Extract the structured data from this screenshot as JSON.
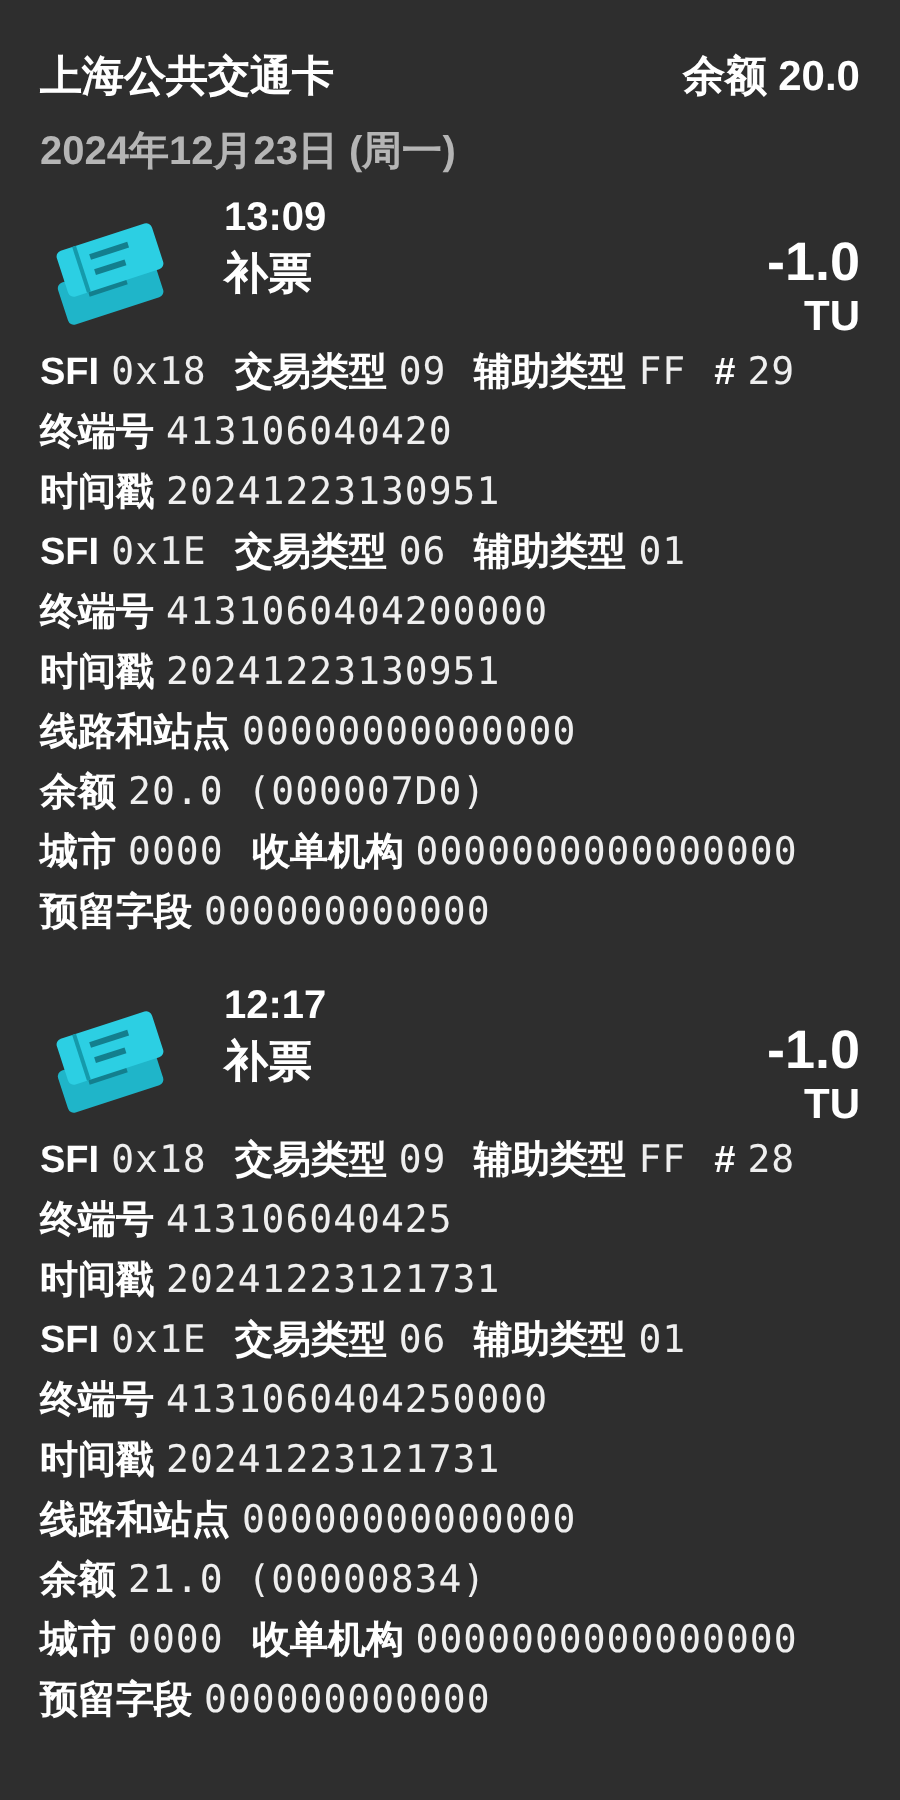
{
  "header": {
    "title": "上海公共交通卡",
    "balance": "余额 20.0"
  },
  "date": "2024年12月23日 (周一)",
  "transactions": [
    {
      "time": "13:09",
      "type": "补票",
      "amount": "-1.0",
      "unit": "TU",
      "details": [
        [
          {
            "label": "SFI",
            "value": "0x18"
          },
          {
            "label": "交易类型",
            "value": "09"
          },
          {
            "label": "辅助类型",
            "value": "FF"
          },
          {
            "label": "#",
            "value": "29"
          }
        ],
        [
          {
            "label": "终端号",
            "value": "413106040420"
          }
        ],
        [
          {
            "label": "时间戳",
            "value": "20241223130951"
          }
        ],
        [
          {
            "label": "SFI",
            "value": "0x1E"
          },
          {
            "label": "交易类型",
            "value": "06"
          },
          {
            "label": "辅助类型",
            "value": "01"
          }
        ],
        [
          {
            "label": "终端号",
            "value": "4131060404200000"
          }
        ],
        [
          {
            "label": "时间戳",
            "value": "20241223130951"
          }
        ],
        [
          {
            "label": "线路和站点",
            "value": "00000000000000"
          }
        ],
        [
          {
            "label": "余额",
            "value": "20.0 (000007D0)"
          }
        ],
        [
          {
            "label": "城市",
            "value": "0000"
          },
          {
            "label": "收单机构",
            "value": "0000000000000000"
          }
        ],
        [
          {
            "label": "预留字段",
            "value": "000000000000"
          }
        ]
      ]
    },
    {
      "time": "12:17",
      "type": "补票",
      "amount": "-1.0",
      "unit": "TU",
      "details": [
        [
          {
            "label": "SFI",
            "value": "0x18"
          },
          {
            "label": "交易类型",
            "value": "09"
          },
          {
            "label": "辅助类型",
            "value": "FF"
          },
          {
            "label": "#",
            "value": "28"
          }
        ],
        [
          {
            "label": "终端号",
            "value": "413106040425"
          }
        ],
        [
          {
            "label": "时间戳",
            "value": "20241223121731"
          }
        ],
        [
          {
            "label": "SFI",
            "value": "0x1E"
          },
          {
            "label": "交易类型",
            "value": "06"
          },
          {
            "label": "辅助类型",
            "value": "01"
          }
        ],
        [
          {
            "label": "终端号",
            "value": "4131060404250000"
          }
        ],
        [
          {
            "label": "时间戳",
            "value": "20241223121731"
          }
        ],
        [
          {
            "label": "线路和站点",
            "value": "00000000000000"
          }
        ],
        [
          {
            "label": "余额",
            "value": "21.0 (00000834)"
          }
        ],
        [
          {
            "label": "城市",
            "value": "0000"
          },
          {
            "label": "收单机构",
            "value": "0000000000000000"
          }
        ],
        [
          {
            "label": "预留字段",
            "value": "000000000000"
          }
        ]
      ]
    }
  ]
}
